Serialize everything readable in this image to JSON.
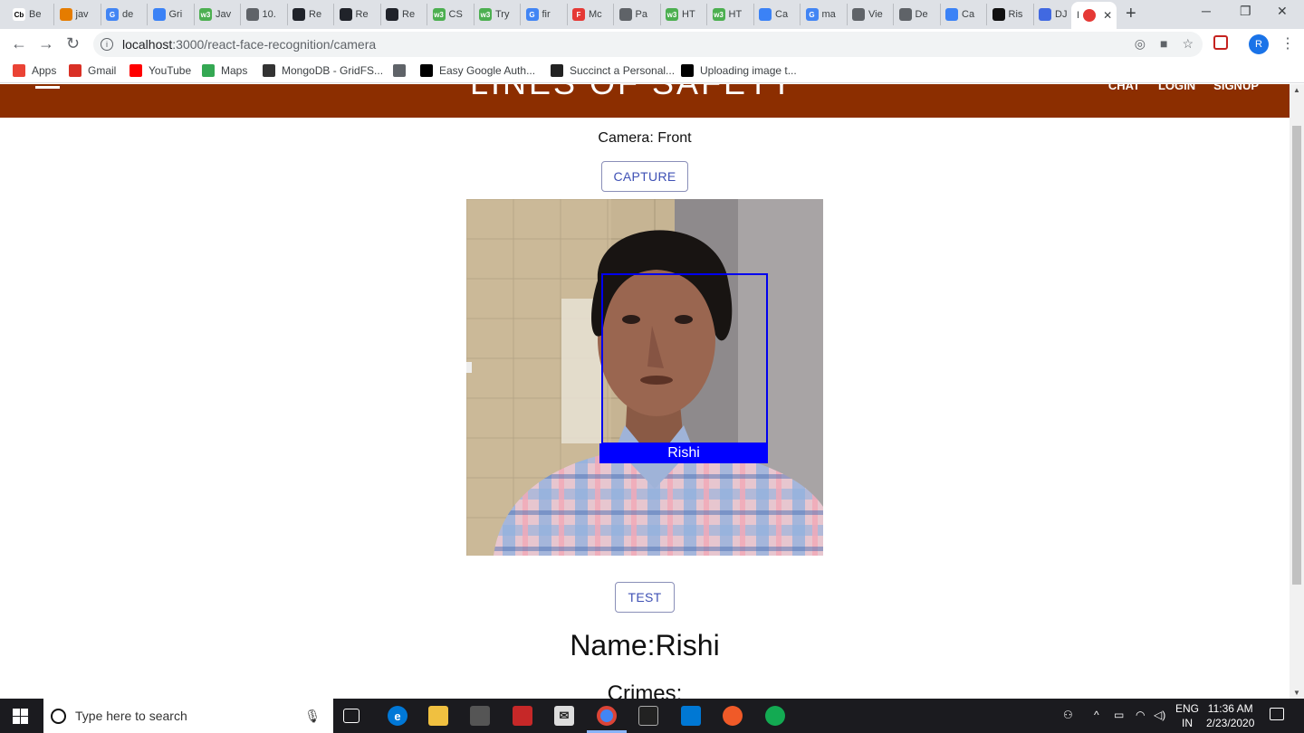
{
  "browser": {
    "tabs": [
      {
        "label": "Be",
        "fav_text": "Cb",
        "fav_color": "#ffffff"
      },
      {
        "label": "jav",
        "fav_text": "",
        "fav_color": "#e57c00"
      },
      {
        "label": "de",
        "fav_text": "G",
        "fav_color": "#4285f4"
      },
      {
        "label": "Gri",
        "fav_text": "",
        "fav_color": "#3b82f6"
      },
      {
        "label": "Jav",
        "fav_text": "w3",
        "fav_color": "#4caf50"
      },
      {
        "label": "10.",
        "fav_text": "",
        "fav_color": "#5f6368"
      },
      {
        "label": "Re",
        "fav_text": "",
        "fav_color": "#20232a"
      },
      {
        "label": "Re",
        "fav_text": "",
        "fav_color": "#20232a"
      },
      {
        "label": "Re",
        "fav_text": "",
        "fav_color": "#20232a"
      },
      {
        "label": "CS",
        "fav_text": "w3",
        "fav_color": "#4caf50"
      },
      {
        "label": "Try",
        "fav_text": "w3",
        "fav_color": "#4caf50"
      },
      {
        "label": "fir",
        "fav_text": "G",
        "fav_color": "#4285f4"
      },
      {
        "label": "Mc",
        "fav_text": "F",
        "fav_color": "#e53935"
      },
      {
        "label": "Pa",
        "fav_text": "",
        "fav_color": "#5f6368"
      },
      {
        "label": "HT",
        "fav_text": "w3",
        "fav_color": "#4caf50"
      },
      {
        "label": "HT",
        "fav_text": "w3",
        "fav_color": "#4caf50"
      },
      {
        "label": "Ca",
        "fav_text": "",
        "fav_color": "#3b82f6"
      },
      {
        "label": "ma",
        "fav_text": "G",
        "fav_color": "#4285f4"
      },
      {
        "label": "Vie",
        "fav_text": "",
        "fav_color": "#5f6368"
      },
      {
        "label": "De",
        "fav_text": "",
        "fav_color": "#5f6368"
      },
      {
        "label": "Ca",
        "fav_text": "",
        "fav_color": "#3b82f6"
      },
      {
        "label": "Ris",
        "fav_text": "",
        "fav_color": "#111111"
      },
      {
        "label": "DJ",
        "fav_text": "",
        "fav_color": "#4169e1"
      }
    ],
    "active_tab": {
      "label": "I",
      "fav_color": "#e53935",
      "close": "✕"
    },
    "new_tab": "+",
    "window_controls": {
      "minimize": "─",
      "maximize": "❐",
      "close": "✕"
    },
    "nav": {
      "back": "←",
      "forward": "→",
      "reload": "↻"
    },
    "url_host": "localhost",
    "url_path": ":3000/react-face-recognition/camera",
    "profile_initial": "R",
    "bookmarks": [
      {
        "label": "Apps",
        "icon": "apps-grid-icon"
      },
      {
        "label": "Gmail",
        "icon": "gmail-icon"
      },
      {
        "label": "YouTube",
        "icon": "youtube-icon"
      },
      {
        "label": "Maps",
        "icon": "maps-icon"
      },
      {
        "label": "MongoDB - GridFS...",
        "icon": "mongodb-icon"
      },
      {
        "label": "",
        "icon": "globe-icon"
      },
      {
        "label": "Easy Google Auth...",
        "icon": "medium-icon"
      },
      {
        "label": "Succinct a Personal...",
        "icon": "w3-icon"
      },
      {
        "label": "Uploading image t...",
        "icon": "medium-icon"
      }
    ]
  },
  "app": {
    "title": "LINES OF SAFETY",
    "nav": [
      "CHAT",
      "LOGIN",
      "SIGNUP"
    ],
    "camera_label": "Camera: Front",
    "capture_label": "CAPTURE",
    "face_label": "Rishi",
    "test_label": "TEST",
    "name_line": "Name:Rishi",
    "crimes_line": "Crimes:"
  },
  "taskbar": {
    "search_placeholder": "Type here to search",
    "lang_top": "ENG",
    "lang_bottom": "IN",
    "time": "11:36 AM",
    "date": "2/23/2020"
  },
  "colors": {
    "appbar": "#8c2e00",
    "face_box": "#0000ff",
    "button_text": "#3f51b5"
  }
}
